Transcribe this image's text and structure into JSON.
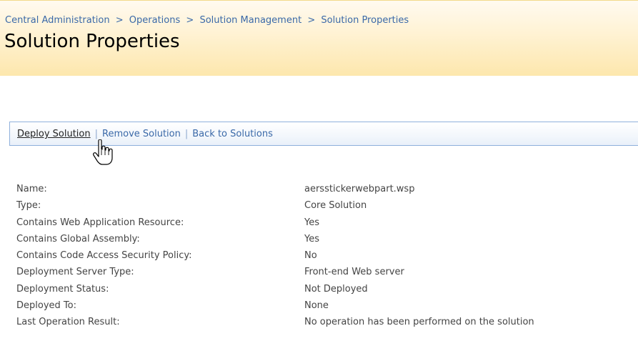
{
  "breadcrumb": {
    "items": [
      "Central Administration",
      "Operations",
      "Solution Management",
      "Solution Properties"
    ],
    "separator": ">"
  },
  "page_title": "Solution Properties",
  "toolbar": {
    "deploy_label": "Deploy Solution",
    "remove_label": "Remove Solution",
    "back_label": "Back to Solutions",
    "separator": "|"
  },
  "properties": [
    {
      "label": "Name:",
      "value": "aersstickerwebpart.wsp"
    },
    {
      "label": "Type:",
      "value": "Core Solution"
    },
    {
      "label": "Contains Web Application Resource:",
      "value": "Yes"
    },
    {
      "label": "Contains Global Assembly:",
      "value": "Yes"
    },
    {
      "label": "Contains Code Access Security Policy:",
      "value": "No"
    },
    {
      "label": "Deployment Server Type:",
      "value": "Front-end Web server"
    },
    {
      "label": "Deployment Status:",
      "value": "Not Deployed"
    },
    {
      "label": "Deployed To:",
      "value": "None"
    },
    {
      "label": "Last Operation Result:",
      "value": "No operation has been performed on the solution"
    }
  ],
  "colors": {
    "link": "#3a69a8",
    "header_band_top": "#fffaf0",
    "header_band_bottom": "#fde7ad",
    "toolbar_border": "#8fb0dc",
    "text": "#444444"
  },
  "cursor": "hand-pointer-icon"
}
